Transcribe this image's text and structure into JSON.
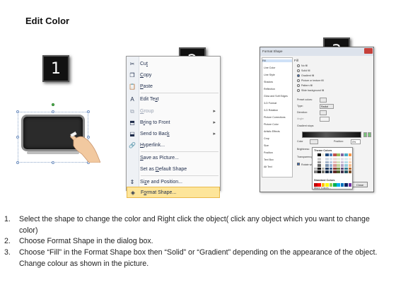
{
  "page": {
    "title": "Edit Color"
  },
  "steps": [
    "1",
    "2",
    "3"
  ],
  "context_menu": {
    "items": [
      {
        "label": "Cut",
        "icon": "scissors-icon",
        "glyph": "✂",
        "accel": "t",
        "disabled": false,
        "submenu": false
      },
      {
        "label": "Copy",
        "icon": "copy-icon",
        "glyph": "❐",
        "accel": "C",
        "disabled": false,
        "submenu": false
      },
      {
        "label": "Paste",
        "icon": "paste-icon",
        "glyph": "📋",
        "accel": "P",
        "disabled": false,
        "submenu": false
      },
      {
        "label": "Edit Text",
        "icon": "edit-text-icon",
        "glyph": "A",
        "accel": "x",
        "disabled": false,
        "submenu": false
      },
      {
        "label": "Group",
        "icon": "group-icon",
        "glyph": "⧉",
        "accel": "G",
        "disabled": true,
        "submenu": true
      },
      {
        "label": "Bring to Front",
        "icon": "bring-to-front-icon",
        "glyph": "⬒",
        "accel": "r",
        "disabled": false,
        "submenu": true
      },
      {
        "label": "Send to Back",
        "icon": "send-to-back-icon",
        "glyph": "⬓",
        "accel": "k",
        "disabled": false,
        "submenu": true
      },
      {
        "label": "Hyperlink...",
        "icon": "hyperlink-icon",
        "glyph": "🔗",
        "accel": "H",
        "disabled": false,
        "submenu": false
      },
      {
        "label": "Save as Picture...",
        "icon": "",
        "glyph": "",
        "accel": "S",
        "disabled": false,
        "submenu": false
      },
      {
        "label": "Set as Default Shape",
        "icon": "",
        "glyph": "",
        "accel": "D",
        "disabled": false,
        "submenu": false
      },
      {
        "label": "Size and Position...",
        "icon": "size-position-icon",
        "glyph": "⇕",
        "accel": "z",
        "disabled": false,
        "submenu": false
      },
      {
        "label": "Format Shape...",
        "icon": "format-shape-icon",
        "glyph": "◈",
        "accel": "o",
        "disabled": false,
        "submenu": false,
        "highlight": true
      }
    ]
  },
  "format_dialog": {
    "title": "Format Shape",
    "categories": [
      "Fill",
      "Line Color",
      "Line Style",
      "Shadow",
      "Reflection",
      "Glow and Soft Edges",
      "3-D Format",
      "3-D Rotation",
      "Picture Corrections",
      "Picture Color",
      "Artistic Effects",
      "Crop",
      "Size",
      "Position",
      "Text Box",
      "Alt Text"
    ],
    "active_category": "Fill",
    "section_title": "Fill",
    "fill_options": [
      {
        "label": "No fill",
        "selected": false
      },
      {
        "label": "Solid fill",
        "selected": false
      },
      {
        "label": "Gradient fill",
        "selected": true
      },
      {
        "label": "Picture or texture fill",
        "selected": false
      },
      {
        "label": "Pattern fill",
        "selected": false
      },
      {
        "label": "Slide background fill",
        "selected": false
      }
    ],
    "preset_colors_label": "Preset colors:",
    "type_label": "Type:",
    "type_value": "Radial",
    "direction_label": "Direction:",
    "angle_label": "Angle:",
    "gradient_stops_label": "Gradient stops",
    "color_label": "Color",
    "position_label": "Position:",
    "position_value": "0%",
    "brightness_label": "Brightness:",
    "transparency_label": "Transparency:",
    "rotate_label": "Rotate with shape",
    "close_label": "Close",
    "theme_colors_label": "Theme Colors",
    "standard_colors_label": "Standard Colors",
    "more_colors_label": "More Colors...",
    "theme_columns": [
      "#ffffff",
      "#000000",
      "#eeece1",
      "#1f497d",
      "#4f81bd",
      "#c0504d",
      "#9bbb59",
      "#8064a2",
      "#4bacc6",
      "#f79646"
    ],
    "standard_colors": [
      "#c00000",
      "#ff0000",
      "#ffc000",
      "#ffff00",
      "#92d050",
      "#00b050",
      "#00b0f0",
      "#0070c0",
      "#002060",
      "#7030a0"
    ]
  },
  "instructions": [
    {
      "num": "1.",
      "text": "Select the shape to change the color and Right click the object( click any object which you want to change color)"
    },
    {
      "num": "2.",
      "text": "Choose Format Shape in the dialog box."
    },
    {
      "num": "3.",
      "text": "Choose “Fill” in the Format Shape box then “Solid” or “Gradient” depending on the appearance of the object. Change colour as shown in the picture."
    }
  ]
}
